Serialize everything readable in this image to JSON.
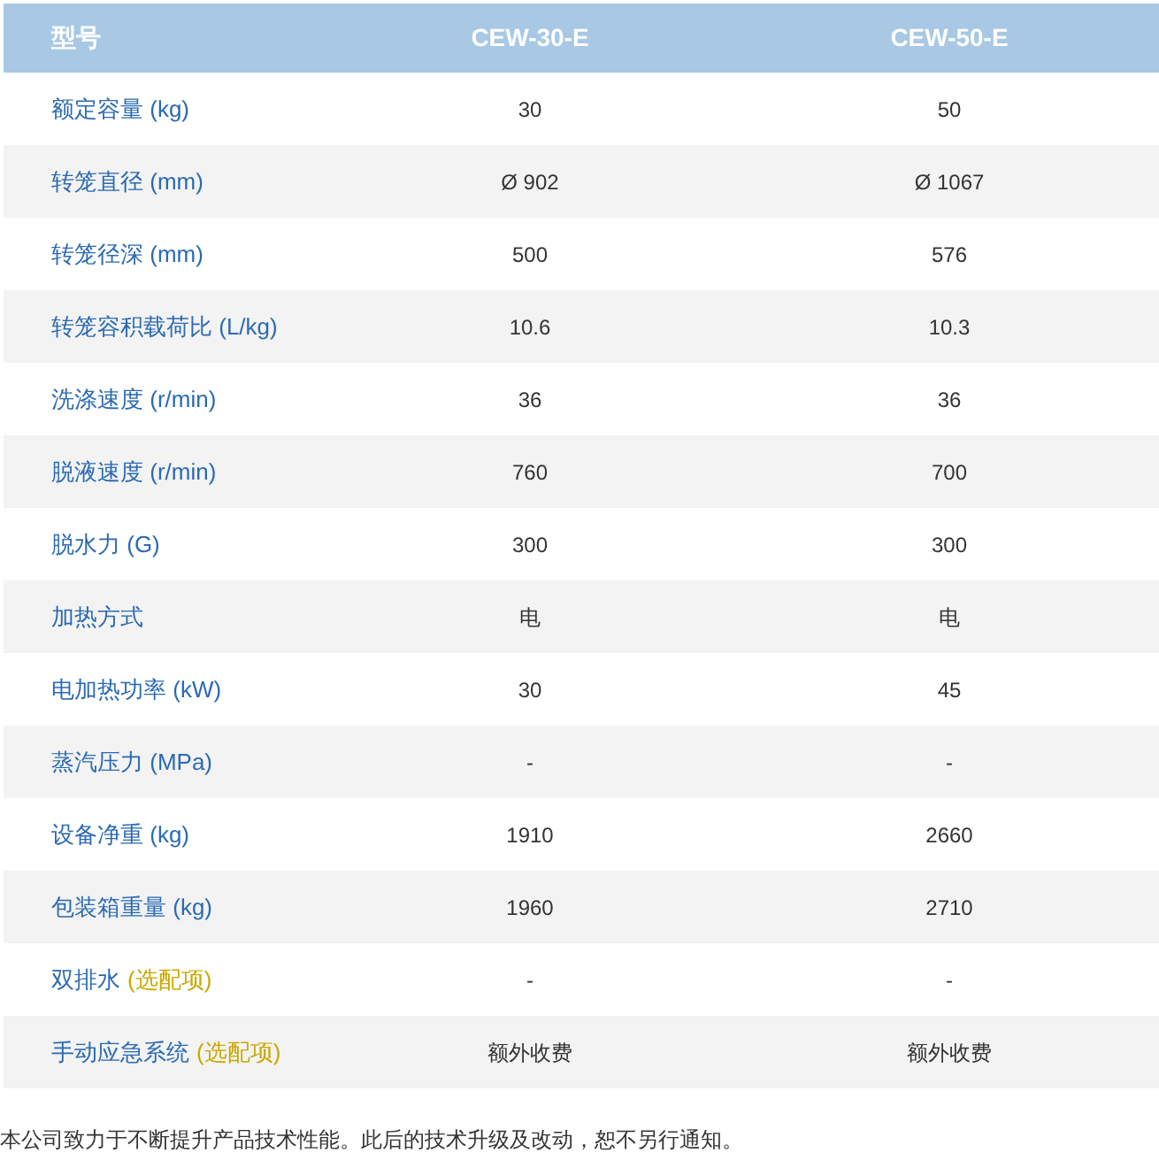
{
  "table": {
    "columns": [
      "型号",
      "CEW-30-E",
      "CEW-50-E"
    ],
    "rows": [
      {
        "label": "额定容量 (kg)",
        "values": [
          "30",
          "50"
        ]
      },
      {
        "label": "转笼直径 (mm)",
        "values": [
          "Ø 902",
          "Ø 1067"
        ]
      },
      {
        "label": "转笼径深 (mm)",
        "values": [
          "500",
          "576"
        ]
      },
      {
        "label": "转笼容积载荷比 (L/kg)",
        "values": [
          "10.6",
          "10.3"
        ]
      },
      {
        "label": "洗涤速度 (r/min)",
        "values": [
          "36",
          "36"
        ]
      },
      {
        "label": "脱液速度 (r/min)",
        "values": [
          "760",
          "700"
        ]
      },
      {
        "label": "脱水力 (G)",
        "values": [
          "300",
          "300"
        ]
      },
      {
        "label": "加热方式",
        "values": [
          "电",
          "电"
        ]
      },
      {
        "label": "电加热功率 (kW)",
        "values": [
          "30",
          "45"
        ]
      },
      {
        "label": "蒸汽压力 (MPa)",
        "values": [
          "-",
          "-"
        ]
      },
      {
        "label": "设备净重 (kg)",
        "values": [
          "1910",
          "2660"
        ]
      },
      {
        "label": "包装箱重量 (kg)",
        "values": [
          "1960",
          "2710"
        ]
      },
      {
        "label": "双排水",
        "note": "(选配项)",
        "values": [
          "-",
          "-"
        ]
      },
      {
        "label": "手动应急系统",
        "note": "(选配项)",
        "values": [
          "额外收费",
          "额外收费"
        ]
      }
    ]
  },
  "footnote": "本公司致力于不断提升产品技术性能。此后的技术升级及改动，恕不另行通知。"
}
